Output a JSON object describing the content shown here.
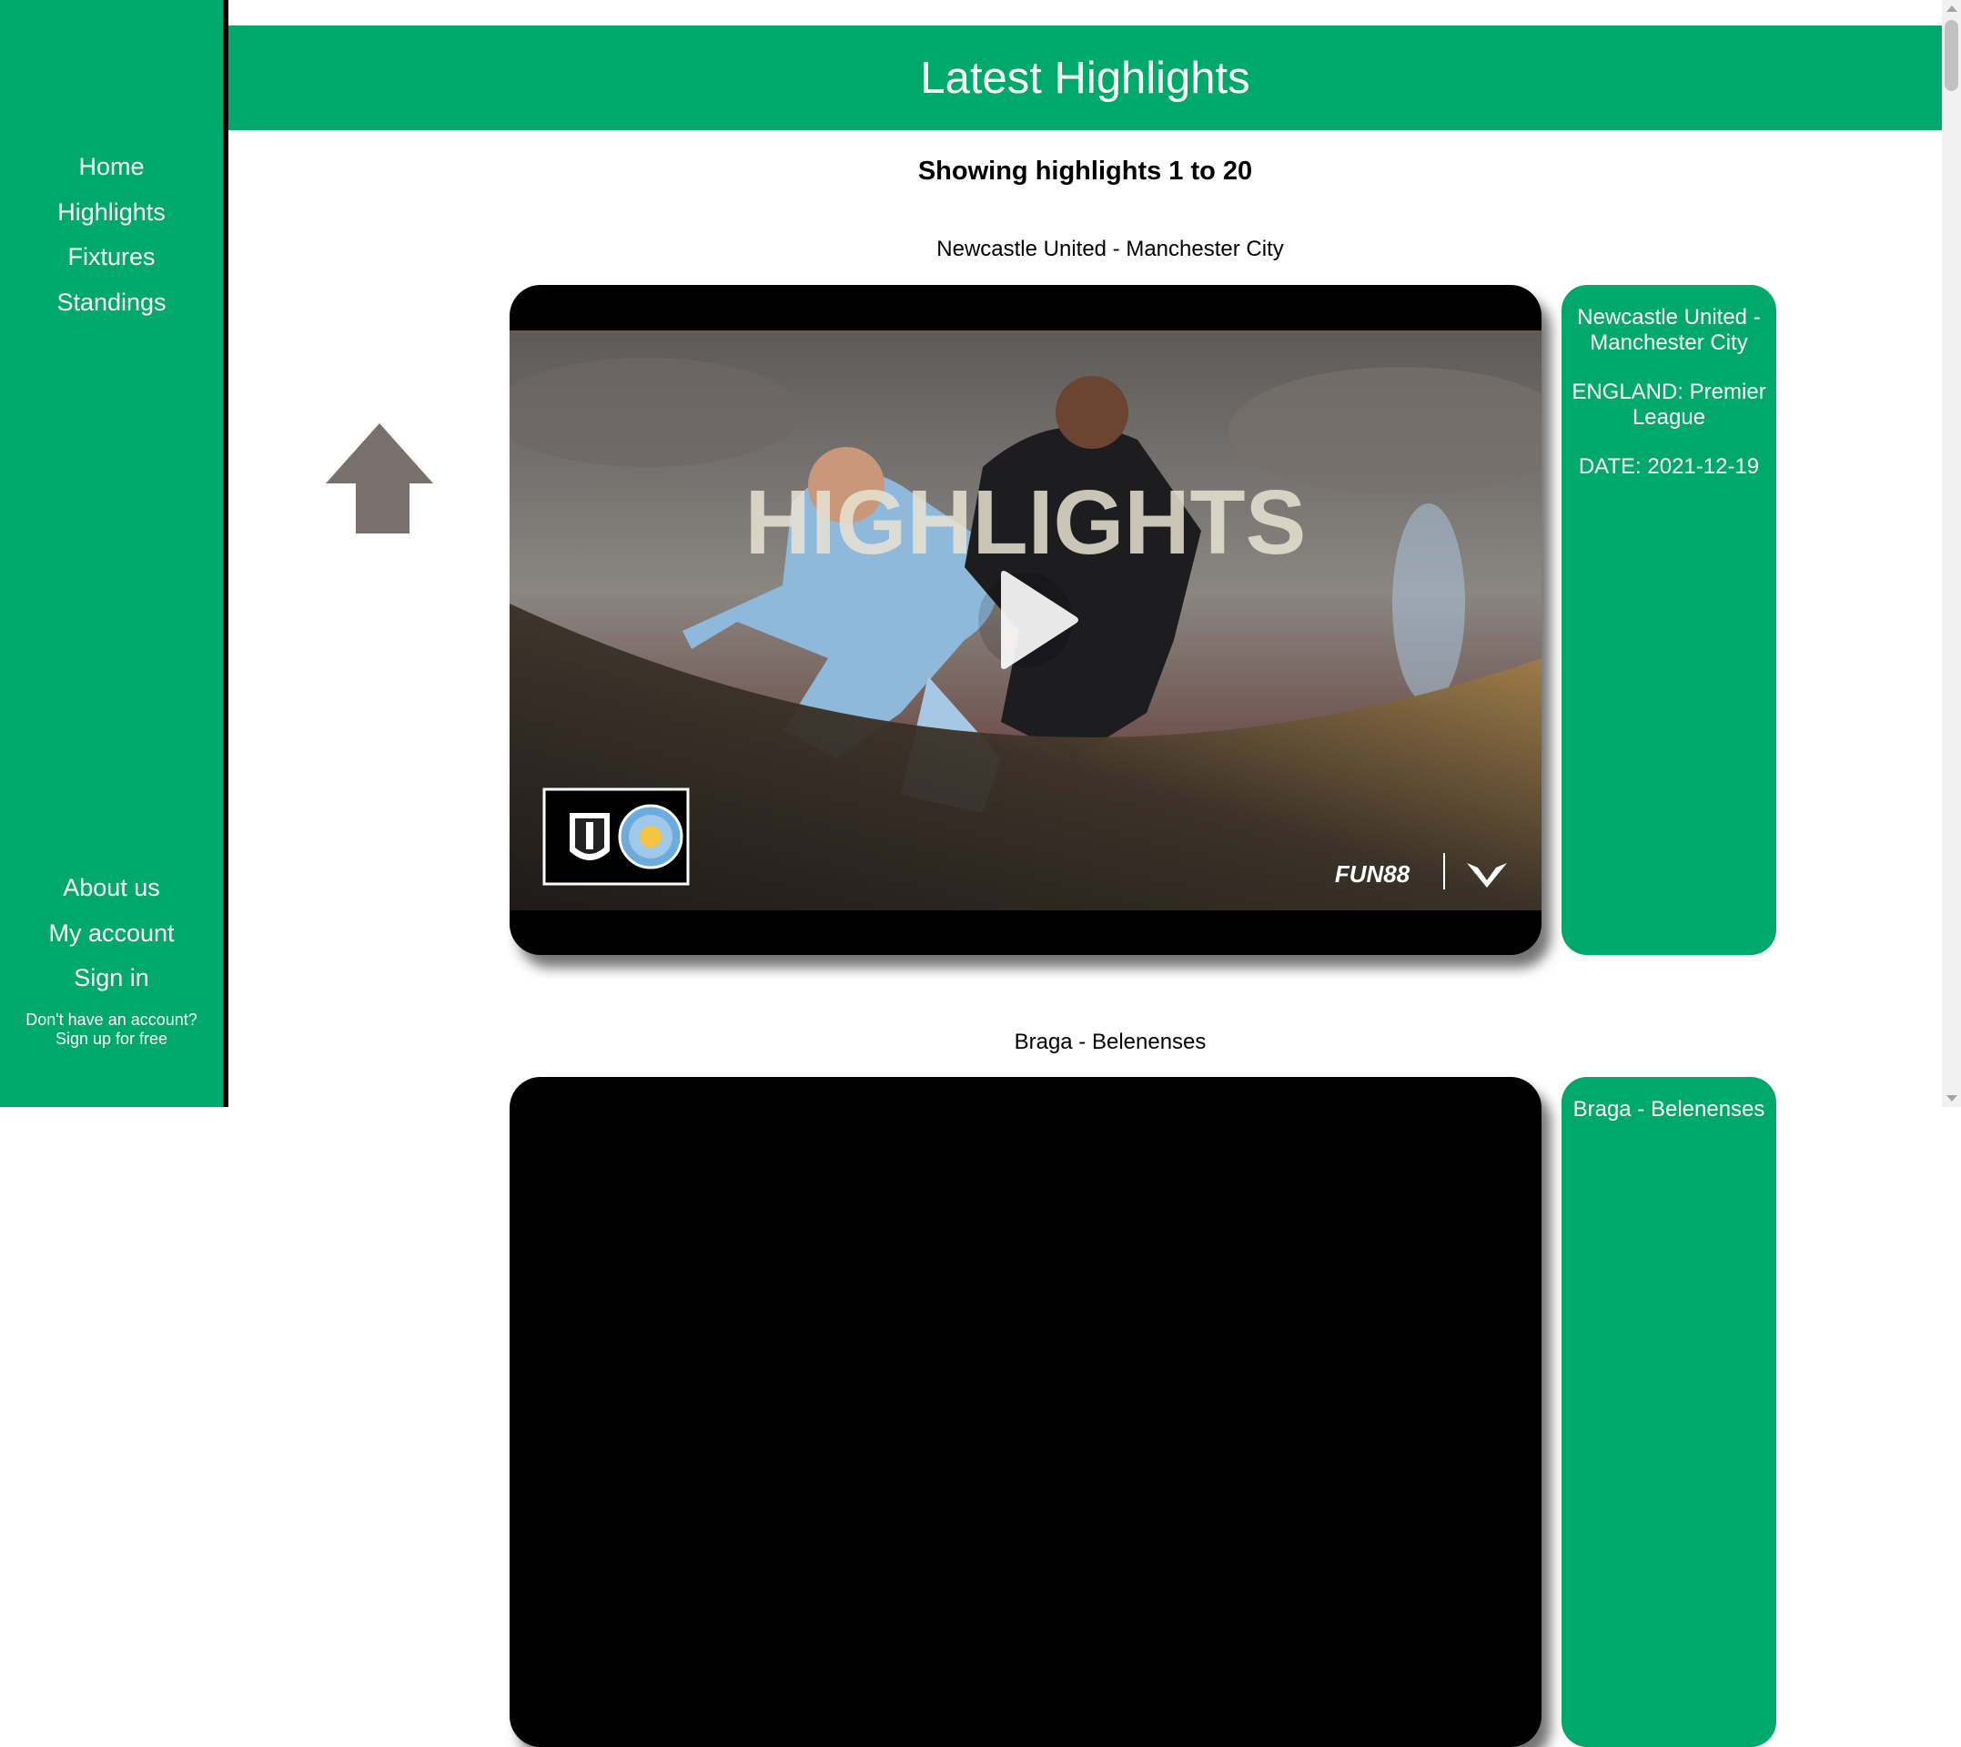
{
  "sidebar": {
    "top_nav": [
      "Home",
      "Highlights",
      "Fixtures",
      "Standings"
    ],
    "bottom_nav": [
      "About us",
      "My account",
      "Sign in"
    ],
    "signup_prompt": "Don't have an account?",
    "signup_link": "Sign up for free"
  },
  "header": {
    "title": "Latest Highlights"
  },
  "main": {
    "showing_text": "Showing highlights 1 to 20",
    "highlights": [
      {
        "title": "Newcastle United - Manchester City",
        "card_match": "Newcastle United - Manchester City",
        "card_league": "ENGLAND: Premier League",
        "card_date": "DATE: 2021-12-19",
        "thumbnail_overlay_text": "HIGHLIGHTS",
        "sponsor_text": "FUN88"
      },
      {
        "title": "Braga - Belenenses",
        "card_match": "Braga - Belenenses"
      }
    ]
  },
  "colors": {
    "brand_green": "#00a86b",
    "sidebar_border": "#000000",
    "arrow_gray": "#7a706b"
  },
  "icons": {
    "back_to_top": "up-arrow-icon",
    "play": "play-icon"
  }
}
